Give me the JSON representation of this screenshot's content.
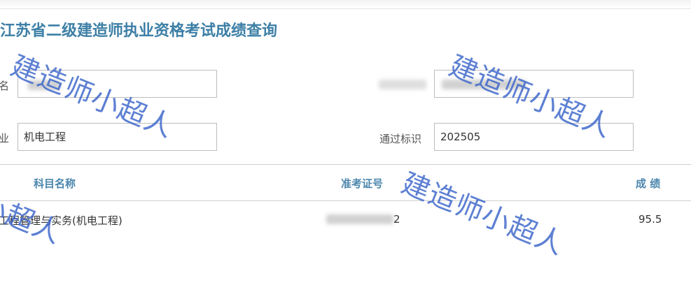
{
  "page": {
    "title": "江苏省二级建造师执业资格考试成绩查询"
  },
  "form": {
    "name_label": "名",
    "specialty_label": "业",
    "specialty_value": "机电工程",
    "pass_label": "通过标识",
    "pass_value": "202505"
  },
  "table": {
    "headers": {
      "subject": "科目名称",
      "exam_no": "准考证号",
      "score": "成 绩"
    },
    "rows": [
      {
        "subject": "工程管理与实务(机电工程)",
        "exam_no_tail": "2",
        "score": "95.5"
      }
    ]
  },
  "watermark": {
    "text": "建造师小超人"
  }
}
